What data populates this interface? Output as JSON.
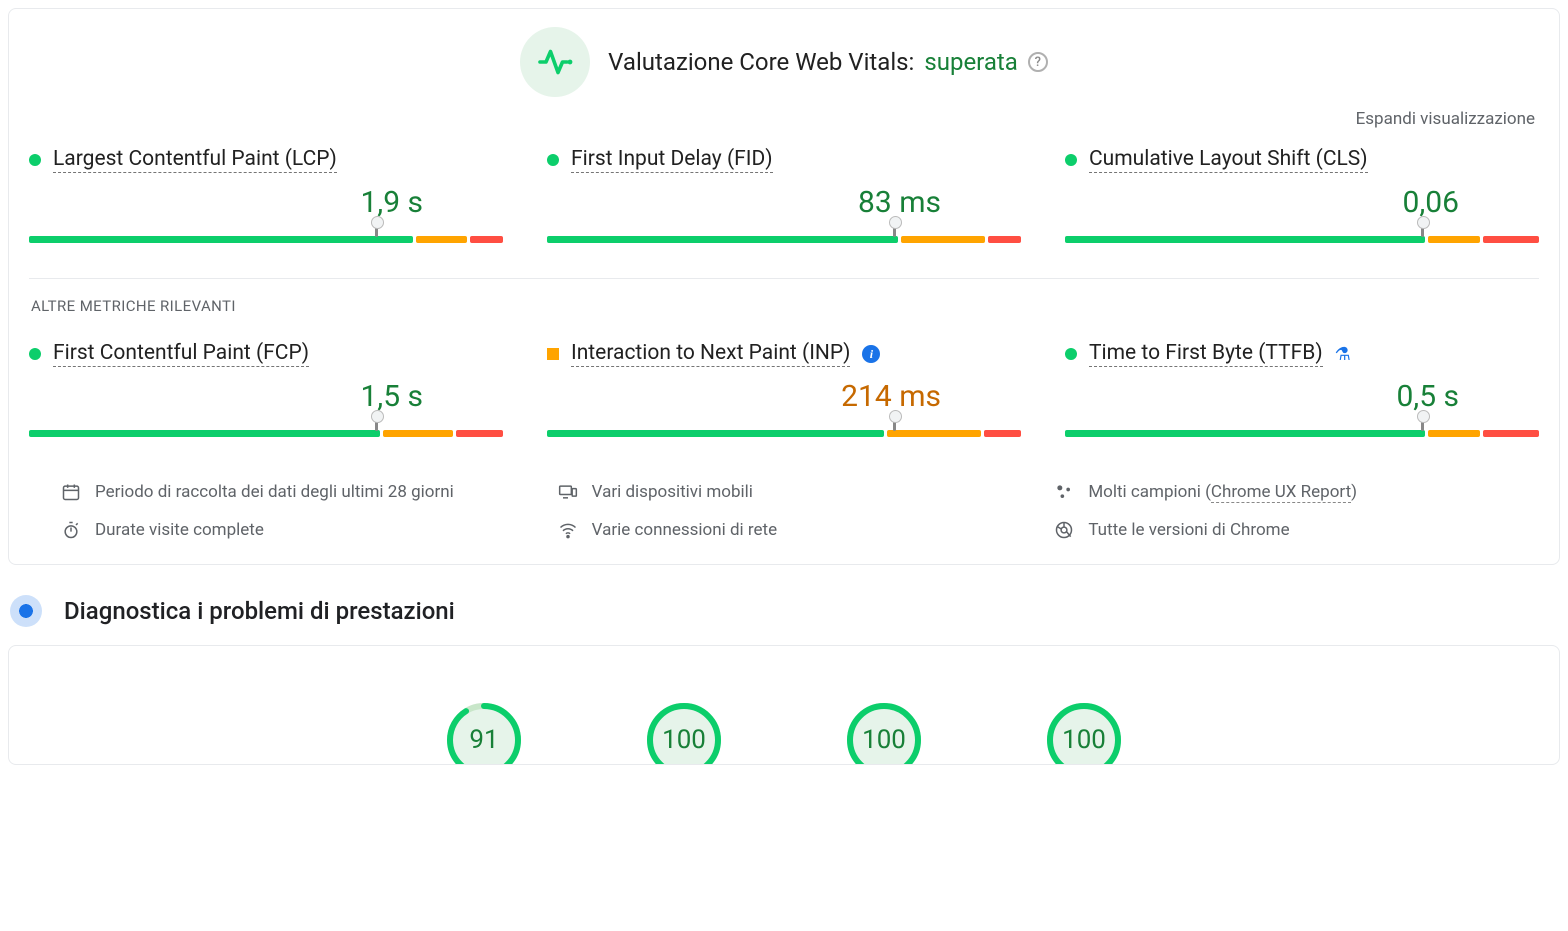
{
  "header": {
    "title_prefix": "Valutazione Core Web Vitals: ",
    "status": "superata"
  },
  "expand_label": "Espandi visualizzazione",
  "core_metrics": [
    {
      "name": "Largest Contentful Paint (LCP)",
      "value": "1,9 s",
      "status": "green",
      "marker_pct": 73,
      "seg_g": 82,
      "seg_o": 11,
      "seg_r": 7
    },
    {
      "name": "First Input Delay (FID)",
      "value": "83 ms",
      "status": "green",
      "marker_pct": 73,
      "seg_g": 75,
      "seg_o": 18,
      "seg_r": 7
    },
    {
      "name": "Cumulative Layout Shift (CLS)",
      "value": "0,06",
      "status": "green",
      "marker_pct": 75,
      "seg_g": 77,
      "seg_o": 11,
      "seg_r": 12
    }
  ],
  "other_section_label": "ALTRE METRICHE RILEVANTI",
  "other_metrics": [
    {
      "name": "First Contentful Paint (FCP)",
      "value": "1,5 s",
      "status": "green",
      "marker_pct": 73,
      "seg_g": 75,
      "seg_o": 15,
      "seg_r": 10,
      "badge": null
    },
    {
      "name": "Interaction to Next Paint (INP)",
      "value": "214 ms",
      "status": "orange",
      "marker_pct": 73,
      "seg_g": 72,
      "seg_o": 20,
      "seg_r": 8,
      "badge": "info"
    },
    {
      "name": "Time to First Byte (TTFB)",
      "value": "0,5 s",
      "status": "green",
      "marker_pct": 75,
      "seg_g": 77,
      "seg_o": 11,
      "seg_r": 12,
      "badge": "flask"
    }
  ],
  "footer": {
    "period": "Periodo di raccolta dei dati degli ultimi 28 giorni",
    "devices": "Vari dispositivi mobili",
    "samples_prefix": "Molti campioni (",
    "samples_link": "Chrome UX Report",
    "samples_suffix": ")",
    "visits": "Durate visite complete",
    "network": "Varie connessioni di rete",
    "chrome": "Tutte le versioni di Chrome"
  },
  "diagnostics_title": "Diagnostica i problemi di prestazioni",
  "scores": [
    91,
    100,
    100,
    100
  ]
}
